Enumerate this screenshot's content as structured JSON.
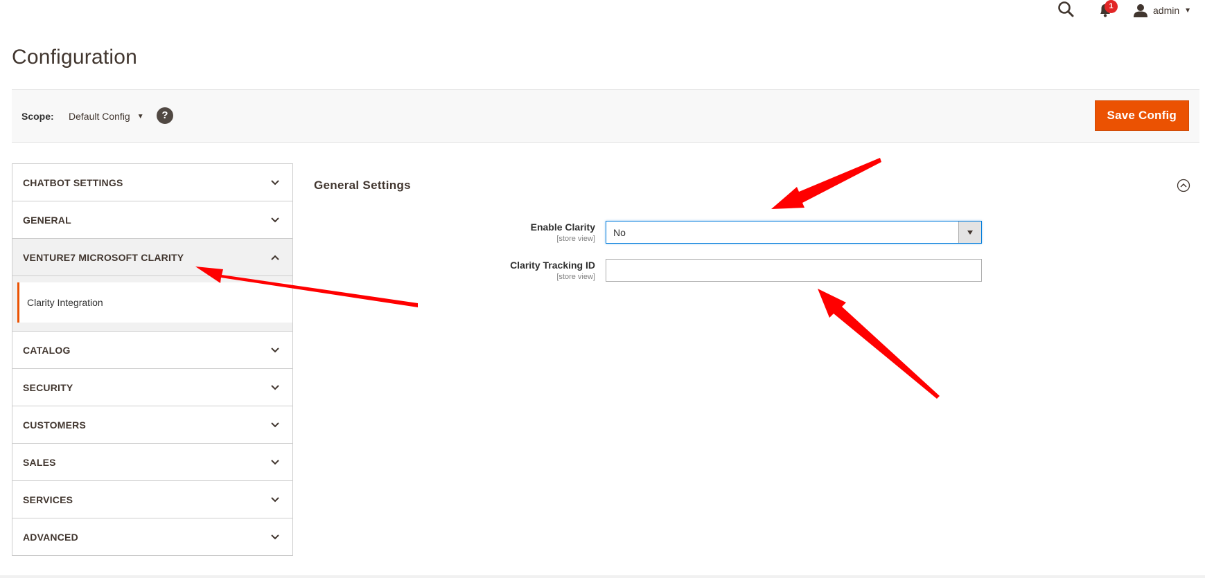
{
  "page": {
    "title": "Configuration"
  },
  "header": {
    "notification_count": "1",
    "user_name": "admin",
    "icons": {
      "search": "search-icon",
      "notifications": "bell-icon",
      "user": "user-icon"
    }
  },
  "scope": {
    "label": "Scope:",
    "value": "Default Config",
    "help": "?",
    "save_label": "Save Config"
  },
  "sidebar": {
    "tabs": [
      {
        "label": "CHATBOT SETTINGS",
        "open": false
      },
      {
        "label": "GENERAL",
        "open": false
      },
      {
        "label": "VENTURE7 MICROSOFT CLARITY",
        "open": true,
        "items": [
          {
            "label": "Clarity Integration",
            "active": true
          }
        ]
      },
      {
        "label": "CATALOG",
        "open": false
      },
      {
        "label": "SECURITY",
        "open": false
      },
      {
        "label": "CUSTOMERS",
        "open": false
      },
      {
        "label": "SALES",
        "open": false
      },
      {
        "label": "SERVICES",
        "open": false
      },
      {
        "label": "ADVANCED",
        "open": false
      }
    ]
  },
  "section": {
    "title": "General Settings",
    "fields": [
      {
        "label": "Enable Clarity",
        "scope": "[store view]",
        "type": "select",
        "value": "No"
      },
      {
        "label": "Clarity Tracking ID",
        "scope": "[store view]",
        "type": "text",
        "value": ""
      }
    ]
  },
  "colors": {
    "accent": "#eb5202",
    "badge": "#e22626",
    "focus": "#007bdb",
    "annotation_arrow": "#ff0000"
  }
}
